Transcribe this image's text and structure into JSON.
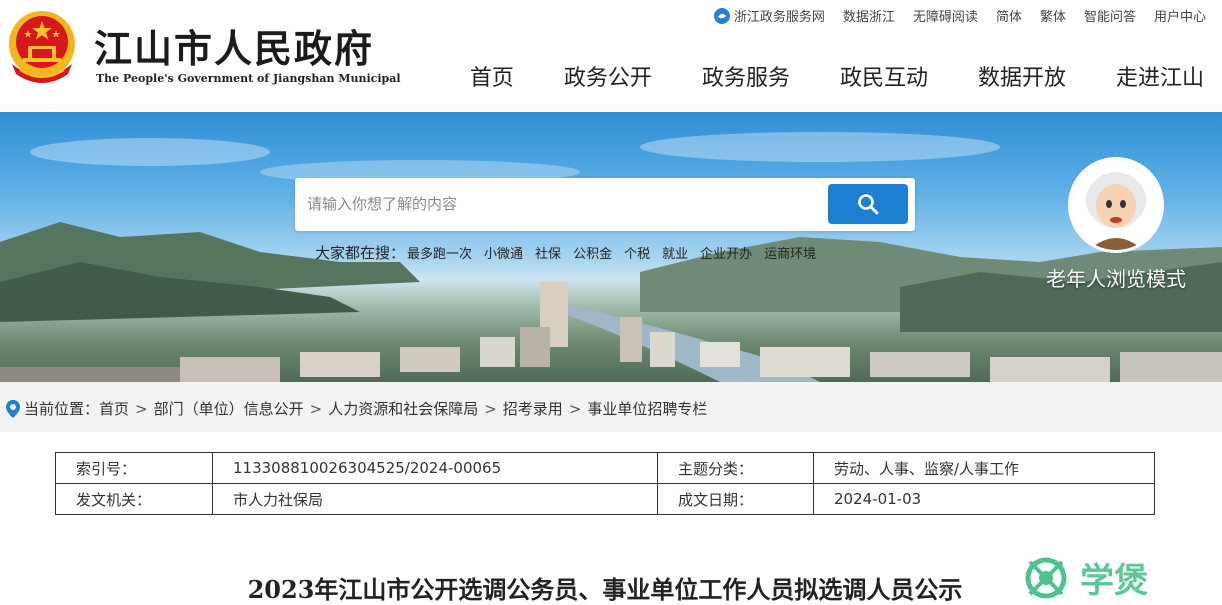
{
  "header": {
    "title": "江山市人民政府",
    "subtitle": "The People's Government of Jiangshan Municipal",
    "top_links": [
      "浙江政务服务网",
      "数据浙江",
      "无障碍阅读",
      "简体",
      "繁体",
      "智能问答",
      "用户中心"
    ],
    "nav": [
      "首页",
      "政务公开",
      "政务服务",
      "政民互动",
      "数据开放",
      "走进江山"
    ]
  },
  "search": {
    "placeholder": "请输入你想了解的内容",
    "hot_label": "大家都在搜：",
    "hot_items": [
      "最多跑一次",
      "小微通",
      "社保",
      "公积金",
      "个税",
      "就业",
      "企业开办",
      "运商环境"
    ]
  },
  "elder_mode": {
    "label": "老年人浏览模式"
  },
  "breadcrumb": {
    "prefix": "当前位置：",
    "items": [
      "首页",
      "部门（单位）信息公开",
      "人力资源和社会保障局",
      "招考录用",
      "事业单位招聘专栏"
    ]
  },
  "info_table": {
    "index_label": "索引号：",
    "index_value": "113308810026304525/2024-00065",
    "topic_label": "主题分类：",
    "topic_value": "劳动、人事、监察/人事工作",
    "issuer_label": "发文机关：",
    "issuer_value": "市人力社保局",
    "date_label": "成文日期：",
    "date_value": "2024-01-03"
  },
  "article": {
    "title": "2023年江山市公开选调公务员、事业单位工作人员拟选调人员公示"
  },
  "watermark": {
    "text": "学煲"
  },
  "colors": {
    "accent": "#1d7fd1",
    "emblem_red": "#d7171c",
    "emblem_gold": "#f6c42a"
  }
}
